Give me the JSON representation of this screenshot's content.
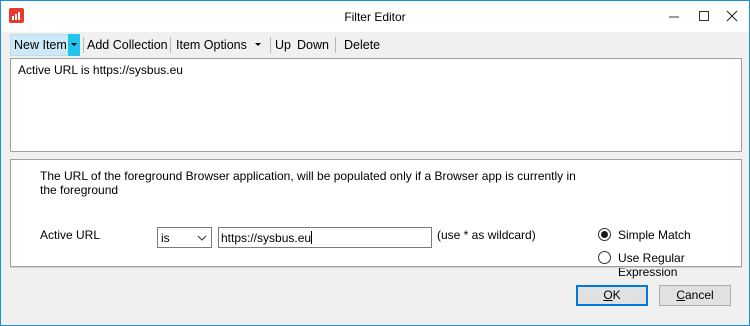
{
  "window": {
    "title": "Filter Editor"
  },
  "toolbar": {
    "new_item": "New Item",
    "add_collection": "Add Collection",
    "item_options": "Item Options",
    "up": "Up",
    "down": "Down",
    "delete": "Delete"
  },
  "filter_list": {
    "items": [
      "Active URL is https://sysbus.eu"
    ]
  },
  "detail": {
    "description": "The URL of the foreground Browser application, will be populated only if a Browser app is currently in the foreground",
    "field_label": "Active URL",
    "operator": "is",
    "value": "https://sysbus.eu",
    "hint": "(use * as wildcard)",
    "match_options": [
      {
        "label": "Simple Match",
        "selected": true
      },
      {
        "label": "Use Regular Expression",
        "selected": false
      }
    ]
  },
  "buttons": {
    "ok_underlined": "O",
    "ok_rest": "K",
    "cancel_underlined": "C",
    "cancel_rest": "ancel"
  },
  "colors": {
    "accent": "#0078d7",
    "window_border": "#1a8fd1",
    "split_arrow": "#20c5ee",
    "app_icon": "#e8392f"
  }
}
